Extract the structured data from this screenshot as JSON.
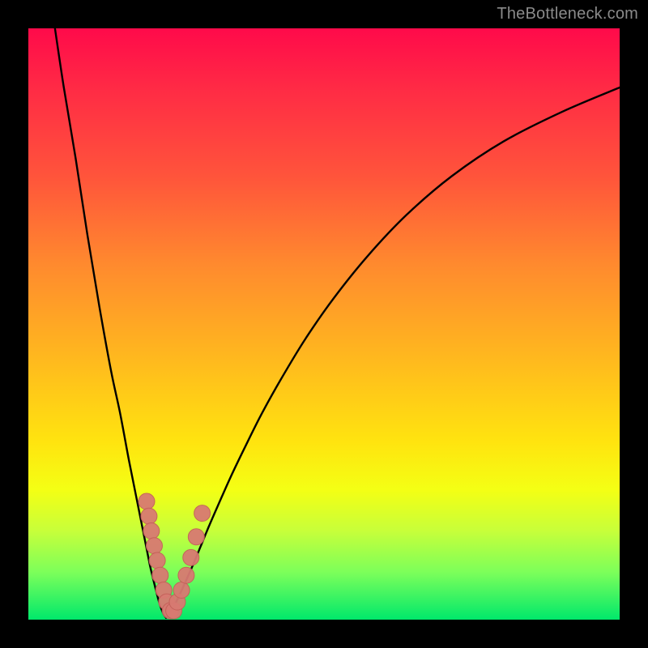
{
  "watermark": "TheBottleneck.com",
  "colors": {
    "frame": "#000000",
    "curve": "#000000",
    "marker_fill": "#d87a72",
    "marker_stroke": "#c46059"
  },
  "chart_data": {
    "type": "line",
    "title": "",
    "xlabel": "",
    "ylabel": "",
    "xlim": [
      0,
      100
    ],
    "ylim": [
      0,
      100
    ],
    "grid": false,
    "legend": false,
    "series": [
      {
        "name": "left-branch",
        "x": [
          4.5,
          6,
          8,
          10,
          12,
          14,
          15.5,
          17,
          18.2,
          19.2,
          20,
          20.6,
          21.2,
          21.7,
          22.1,
          22.5,
          22.9,
          23.3
        ],
        "values": [
          100,
          90,
          78,
          65,
          53,
          42,
          35,
          27,
          21,
          16,
          12,
          9,
          6.5,
          4.5,
          3.0,
          1.8,
          0.9,
          0.3
        ]
      },
      {
        "name": "right-branch",
        "x": [
          23.3,
          23.8,
          24.4,
          25.1,
          25.9,
          26.8,
          27.9,
          29.1,
          30.5,
          32.2,
          34.2,
          36.6,
          39.4,
          42.8,
          46.8,
          51.6,
          57.3,
          63.9,
          71.6,
          80.4,
          90.3,
          100
        ],
        "values": [
          0.3,
          0.9,
          1.9,
          3.2,
          4.9,
          6.9,
          9.4,
          12.3,
          15.7,
          19.6,
          24.1,
          29.1,
          34.7,
          40.8,
          47.4,
          54.3,
          61.4,
          68.4,
          75.0,
          80.9,
          85.9,
          90.0
        ]
      }
    ],
    "markers": {
      "name": "highlighted-points",
      "x": [
        20.0,
        20.4,
        20.8,
        21.3,
        21.8,
        22.3,
        22.9,
        23.4,
        24.0,
        24.6,
        25.2,
        25.9,
        26.7,
        27.5,
        28.4,
        29.4
      ],
      "values": [
        20.0,
        17.5,
        15.0,
        12.5,
        10.0,
        7.5,
        5.0,
        3.0,
        1.5,
        1.5,
        3.0,
        5.0,
        7.5,
        10.5,
        14.0,
        18.0
      ],
      "radius": 10
    }
  }
}
